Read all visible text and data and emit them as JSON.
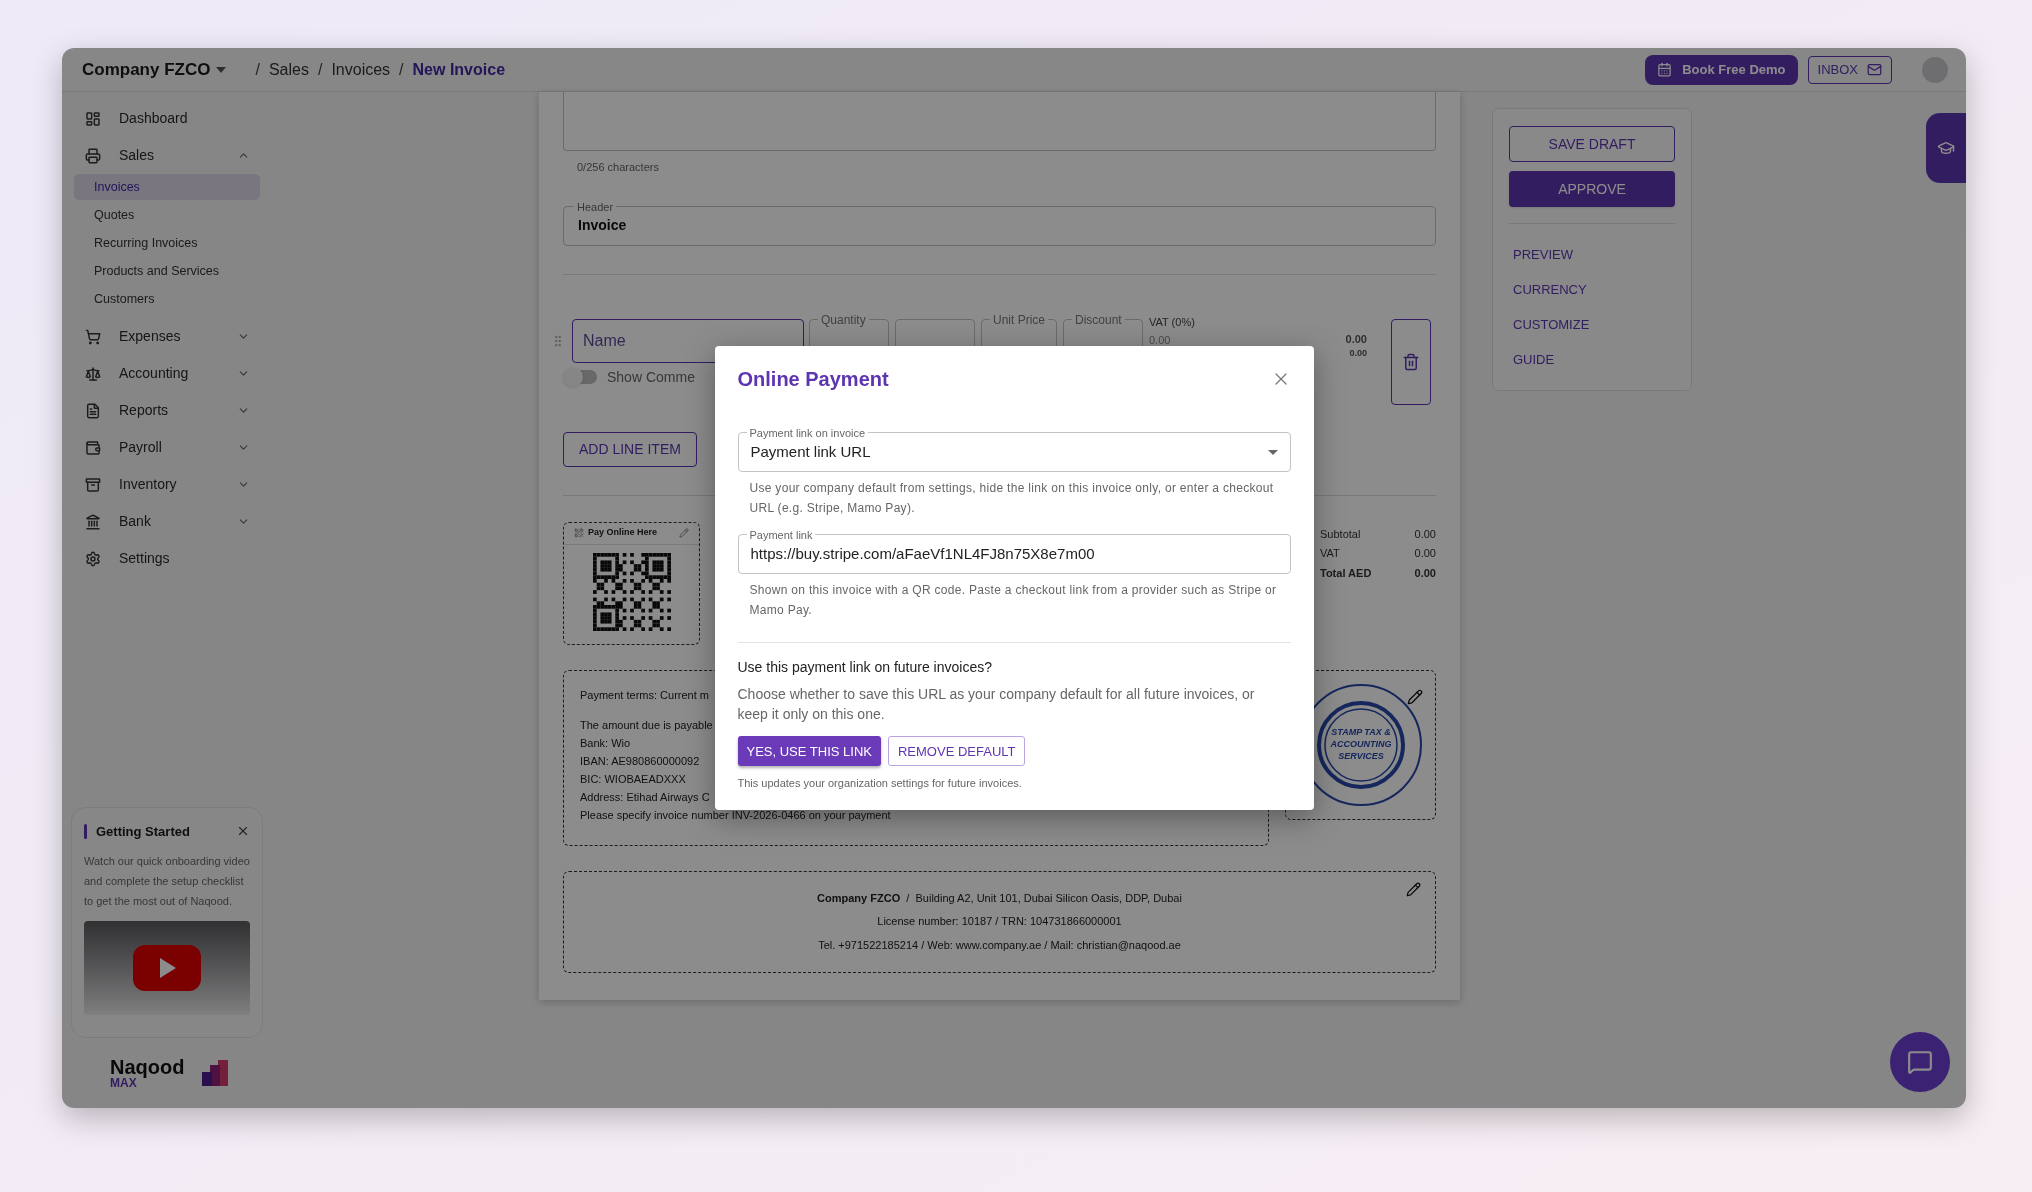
{
  "header": {
    "company": "Company FZCO",
    "breadcrumbs": [
      {
        "label": "Sales",
        "current": false
      },
      {
        "label": "Invoices",
        "current": false
      },
      {
        "label": "New Invoice",
        "current": true
      }
    ],
    "separator": "/",
    "demo_button": "Book Free Demo",
    "inbox_button": "INBOX"
  },
  "sidebar": {
    "items": [
      {
        "label": "Dashboard",
        "kind": "dashboard"
      },
      {
        "label": "Sales",
        "kind": "register",
        "expanded": true,
        "children": [
          {
            "label": "Invoices",
            "selected": true
          },
          {
            "label": "Quotes",
            "selected": false
          },
          {
            "label": "Recurring Invoices",
            "selected": false
          },
          {
            "label": "Products and Services",
            "selected": false
          },
          {
            "label": "Customers",
            "selected": false
          }
        ]
      },
      {
        "label": "Expenses",
        "kind": "cart",
        "expanded": false
      },
      {
        "label": "Accounting",
        "kind": "scale",
        "expanded": false
      },
      {
        "label": "Reports",
        "kind": "report",
        "expanded": false
      },
      {
        "label": "Payroll",
        "kind": "wallet",
        "expanded": false
      },
      {
        "label": "Inventory",
        "kind": "archive",
        "expanded": false
      },
      {
        "label": "Bank",
        "kind": "bank",
        "expanded": false
      },
      {
        "label": "Settings",
        "kind": "gear"
      }
    ]
  },
  "getting_started": {
    "title": "Getting Started",
    "text": "Watch our quick onboarding video and complete the setup checklist to get the most out of Naqood."
  },
  "brand": {
    "name": "Naqood",
    "tier": "MAX"
  },
  "invoice": {
    "char_count": "0/256 characters",
    "header_field": {
      "label": "Header",
      "value": "Invoice"
    },
    "line_item": {
      "name_placeholder": "Name",
      "fields": [
        {
          "kind": "labeled",
          "label": "Quantity"
        },
        {
          "kind": "plain"
        },
        {
          "kind": "labeled",
          "label": "Unit Price"
        },
        {
          "kind": "labeled",
          "label": "Discount"
        }
      ],
      "vat_label": "VAT (0%)",
      "vat_value": "0.00",
      "amounts": [
        "0.00",
        "0.00"
      ]
    },
    "show_comments": {
      "label": "Show Comme",
      "on": false
    },
    "add_button": "ADD LINE ITEM",
    "pay_online": "Pay Online Here",
    "totals": [
      {
        "label": "Subtotal",
        "value": "0.00",
        "bold": false
      },
      {
        "label": "VAT",
        "value": "0.00",
        "bold": false
      },
      {
        "label": "Total AED",
        "value": "0.00",
        "bold": true
      }
    ],
    "payment_terms": [
      [
        "Payment terms: Current m"
      ],
      [
        "The amount due is payable",
        "Bank: Wio",
        "IBAN: AE980860000092",
        "BIC: WIOBAEADXXX",
        "Address: Etihad Airways C",
        "Please specify invoice number INV-2026-0466 on your payment"
      ]
    ],
    "stamp": [
      "STAMP TAX &",
      "ACCOUNTING",
      "SERVICES"
    ],
    "footer": [
      "**Company FZCO**  /  Building A2, Unit 101, Dubai Silicon Oasis, DDP, Dubai",
      "License number: 10187 / TRN: 104731866000001",
      "Tel. +971522185214 / Web: www.company.ae / Mail: christian@naqood.ae"
    ]
  },
  "actions": {
    "save": "SAVE DRAFT",
    "approve": "APPROVE",
    "links": [
      "PREVIEW",
      "CURRENCY",
      "CUSTOMIZE",
      "GUIDE"
    ]
  },
  "modal": {
    "title": "Online Payment",
    "select": {
      "label": "Payment link on invoice",
      "value": "Payment link URL",
      "helper": "Use your company default from settings, hide the link on this invoice only, or enter a checkout URL (e.g. Stripe, Mamo Pay)."
    },
    "link_field": {
      "label": "Payment link",
      "value": "https://buy.stripe.com/aFaeVf1NL4FJ8n75X8e7m00",
      "helper": "Shown on this invoice with a QR code. Paste a checkout link from a provider such as Stripe or Mamo Pay."
    },
    "question": "Use this payment link on future invoices?",
    "description": "Choose whether to save this URL as your company default for all future invoices, or keep it only on this one.",
    "buttons": [
      {
        "label": "YES, USE THIS LINK",
        "kind": "primary"
      },
      {
        "label": "REMOVE DEFAULT",
        "kind": "outlined"
      }
    ],
    "note": "This updates your organization settings for future invoices."
  }
}
